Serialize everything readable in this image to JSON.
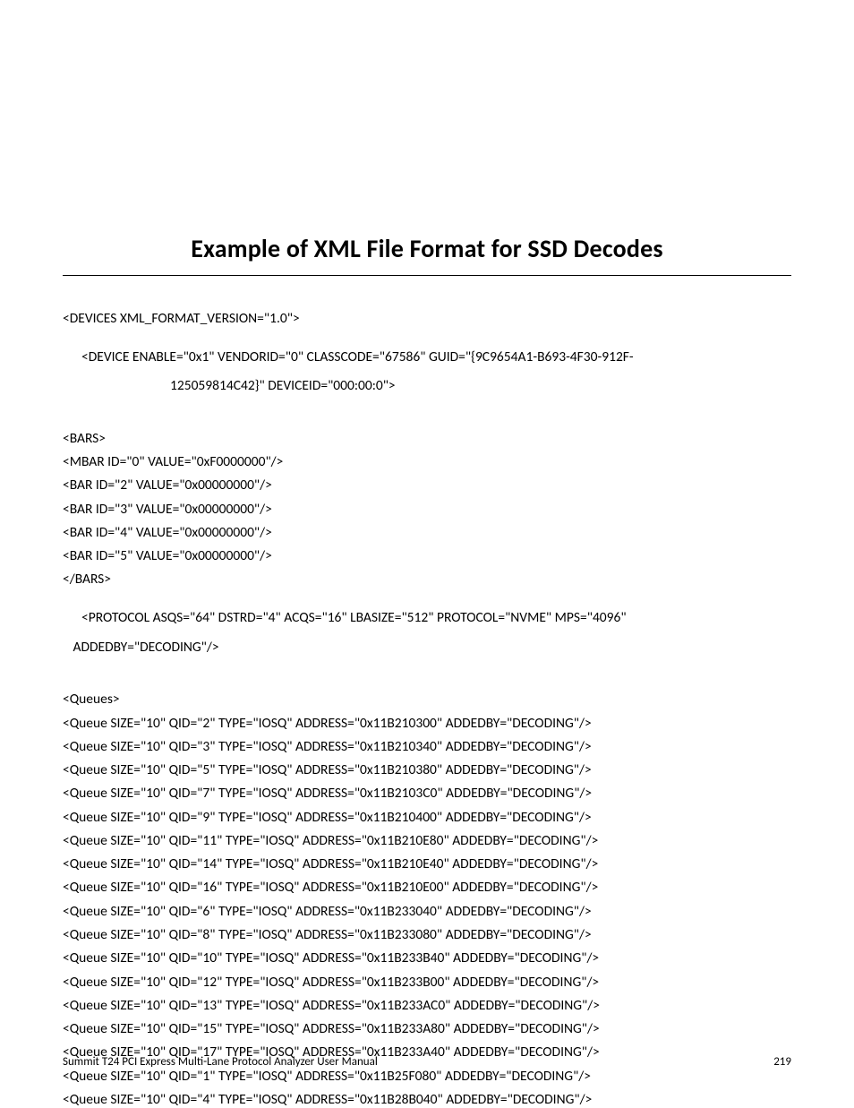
{
  "title": "Example of XML File Format for SSD Decodes",
  "xml": {
    "devices_open": "<DEVICES XML_FORMAT_VERSION=\"1.0\">",
    "device_open_l1": "<DEVICE ENABLE=\"0x1\" VENDORID=\"0\" CLASSCODE=\"67586\" GUID=\"{9C9654A1-B693-4F30-912F-",
    "device_open_l2": "125059814C42}\" DEVICEID=\"000:00:0\">",
    "bars_open": "<BARS>",
    "mbar": "<MBAR ID=\"0\" VALUE=\"0xF0000000\"/>",
    "bar2": "<BAR ID=\"2\" VALUE=\"0x00000000\"/>",
    "bar3": "<BAR ID=\"3\" VALUE=\"0x00000000\"/>",
    "bar4": "<BAR ID=\"4\" VALUE=\"0x00000000\"/>",
    "bar5": "<BAR ID=\"5\" VALUE=\"0x00000000\"/>",
    "bars_close": "</BARS>",
    "protocol_l1": "<PROTOCOL ASQS=\"64\" DSTRD=\"4\" ACQS=\"16\" LBASIZE=\"512\" PROTOCOL=\"NVME\" MPS=\"4096\"",
    "protocol_l2": " ADDEDBY=\"DECODING\"/>",
    "queues_open": "<Queues>",
    "queues": [
      "<Queue SIZE=\"10\" QID=\"2\" TYPE=\"IOSQ\" ADDRESS=\"0x11B210300\" ADDEDBY=\"DECODING\"/>",
      "<Queue SIZE=\"10\" QID=\"3\" TYPE=\"IOSQ\" ADDRESS=\"0x11B210340\" ADDEDBY=\"DECODING\"/>",
      "<Queue SIZE=\"10\" QID=\"5\" TYPE=\"IOSQ\" ADDRESS=\"0x11B210380\" ADDEDBY=\"DECODING\"/>",
      "<Queue SIZE=\"10\" QID=\"7\" TYPE=\"IOSQ\" ADDRESS=\"0x11B2103C0\" ADDEDBY=\"DECODING\"/>",
      "<Queue SIZE=\"10\" QID=\"9\" TYPE=\"IOSQ\" ADDRESS=\"0x11B210400\" ADDEDBY=\"DECODING\"/>",
      "<Queue SIZE=\"10\" QID=\"11\" TYPE=\"IOSQ\" ADDRESS=\"0x11B210E80\" ADDEDBY=\"DECODING\"/>",
      "<Queue SIZE=\"10\" QID=\"14\" TYPE=\"IOSQ\" ADDRESS=\"0x11B210E40\" ADDEDBY=\"DECODING\"/>",
      "<Queue SIZE=\"10\" QID=\"16\" TYPE=\"IOSQ\" ADDRESS=\"0x11B210E00\" ADDEDBY=\"DECODING\"/>",
      "<Queue SIZE=\"10\" QID=\"6\" TYPE=\"IOSQ\" ADDRESS=\"0x11B233040\" ADDEDBY=\"DECODING\"/>",
      "<Queue SIZE=\"10\" QID=\"8\" TYPE=\"IOSQ\" ADDRESS=\"0x11B233080\" ADDEDBY=\"DECODING\"/>",
      "<Queue SIZE=\"10\" QID=\"10\" TYPE=\"IOSQ\" ADDRESS=\"0x11B233B40\" ADDEDBY=\"DECODING\"/>",
      "<Queue SIZE=\"10\" QID=\"12\" TYPE=\"IOSQ\" ADDRESS=\"0x11B233B00\" ADDEDBY=\"DECODING\"/>",
      "<Queue SIZE=\"10\" QID=\"13\" TYPE=\"IOSQ\" ADDRESS=\"0x11B233AC0\" ADDEDBY=\"DECODING\"/>",
      "<Queue SIZE=\"10\" QID=\"15\" TYPE=\"IOSQ\" ADDRESS=\"0x11B233A80\" ADDEDBY=\"DECODING\"/>",
      "<Queue SIZE=\"10\" QID=\"17\" TYPE=\"IOSQ\" ADDRESS=\"0x11B233A40\" ADDEDBY=\"DECODING\"/>",
      "<Queue SIZE=\"10\" QID=\"1\" TYPE=\"IOSQ\" ADDRESS=\"0x11B25F080\" ADDEDBY=\"DECODING\"/>",
      "<Queue SIZE=\"10\" QID=\"4\" TYPE=\"IOSQ\" ADDRESS=\"0x11B28B040\" ADDEDBY=\"DECODING\"/>"
    ]
  },
  "footer": {
    "left": "Summit T24 PCI Express Multi-Lane Protocol Analyzer User Manual",
    "right": "219"
  }
}
